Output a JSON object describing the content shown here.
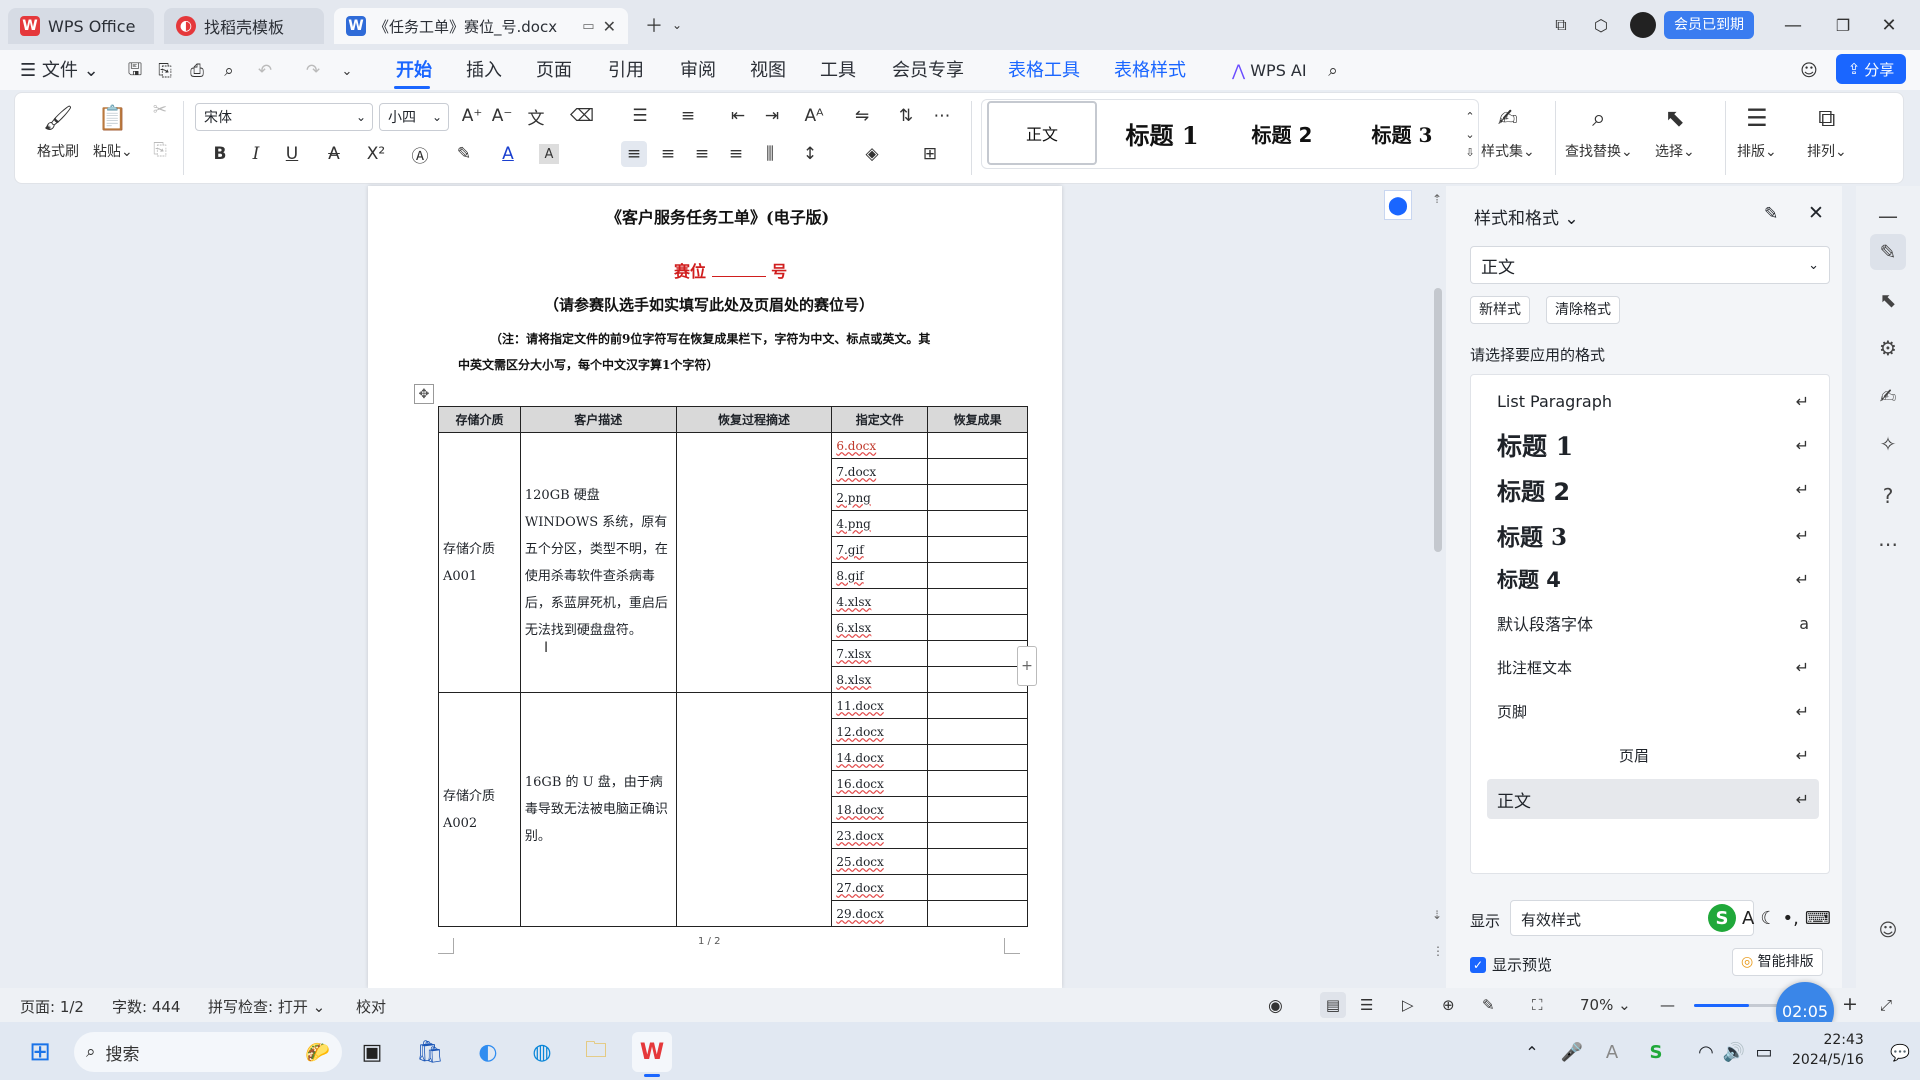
{
  "titlebar": {
    "tabs": [
      {
        "label": "WPS Office"
      },
      {
        "label": "找稻壳模板"
      },
      {
        "label": "《任务工单》赛位_号.docx"
      }
    ],
    "member_badge": "会员已到期"
  },
  "menubar": {
    "file": "文件",
    "items": [
      "开始",
      "插入",
      "页面",
      "引用",
      "审阅",
      "视图",
      "工具",
      "会员专享",
      "表格工具",
      "表格样式"
    ],
    "wps_ai": "WPS AI",
    "share": "分享"
  },
  "ribbon": {
    "format_painter": "格式刷",
    "paste": "粘贴",
    "font_name": "宋体",
    "font_size": "小四",
    "styles": [
      "正文",
      "标题 1",
      "标题 2",
      "标题 3"
    ],
    "style_set": "样式集",
    "find_replace": "查找替换",
    "select": "选择",
    "layout": "排版",
    "arrange": "排列"
  },
  "document": {
    "title": "《客户服务任务工单》(电子版)",
    "seat_prefix": "赛位",
    "seat_suffix": "号",
    "instruction": "（请参赛队选手如实填写此处及页眉处的赛位号）",
    "note_line1": "（注：请将指定文件的前9位字符写在恢复成果栏下，字符为中文、标点或英文。其",
    "note_line2": "中英文需区分大小写，每个中文汉字算1个字符）",
    "table_headers": [
      "存储介质",
      "客户描述",
      "恢复过程摘述",
      "指定文件",
      "恢复成果"
    ],
    "groups": [
      {
        "medium": "存储介质A001",
        "description": "120GB 硬盘 WINDOWS 系统，原有五个分区，类型不明，在使用杀毒软件查杀病毒后，系蓝屏死机，重启后无法找到硬盘盘符。",
        "files": [
          "6.docx",
          "7.docx",
          "2.png",
          "4.png",
          "7.gif",
          "8.gif",
          "4.xlsx",
          "6.xlsx",
          "7.xlsx",
          "8.xlsx"
        ]
      },
      {
        "medium": "存储介质A002",
        "description": "16GB 的 U 盘，由于病毒导致无法被电脑正确识别。",
        "files": [
          "11.docx",
          "12.docx",
          "14.docx",
          "16.docx",
          "18.docx",
          "23.docx",
          "25.docx",
          "27.docx",
          "29.docx"
        ]
      }
    ],
    "page_footer": "1 / 2"
  },
  "panel": {
    "title": "样式和格式",
    "current_style": "正文",
    "new_style": "新样式",
    "clear_format": "清除格式",
    "prompt": "请选择要应用的格式",
    "styles": [
      "List Paragraph",
      "标题 1",
      "标题 2",
      "标题 3",
      "标题 4",
      "默认段落字体",
      "批注框文本",
      "页脚",
      "页眉",
      "正文"
    ],
    "show_label": "显示",
    "show_value": "有效样式",
    "preview_label": "显示预览",
    "smart_layout": "智能排版"
  },
  "status": {
    "page": "页面: 1/2",
    "words": "字数: 444",
    "spell": "拼写检查: 打开",
    "proof": "校对",
    "zoom": "70%",
    "timer": "02:05"
  },
  "taskbar": {
    "search": "搜索",
    "time": "22:43",
    "date": "2024/5/16"
  }
}
